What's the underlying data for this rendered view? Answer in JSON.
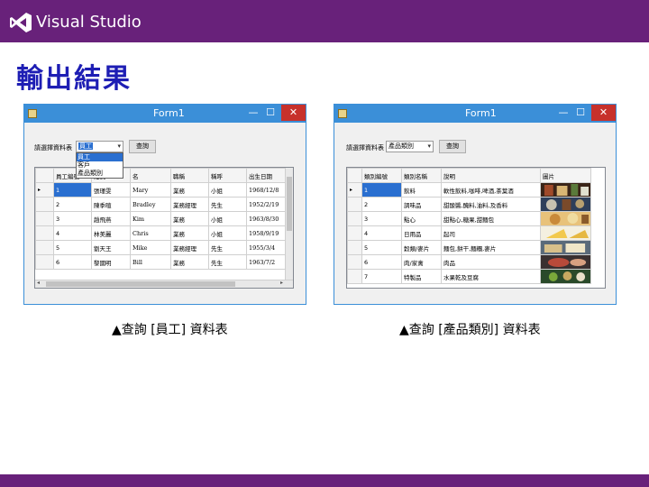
{
  "header": {
    "brand": "Visual Studio"
  },
  "slide_title": "輸出結果",
  "colors": {
    "brand_purple": "#68217a",
    "title_blue": "#1e1eb4",
    "window_blue": "#3b8fd8",
    "selection": "#2a6fd0"
  },
  "left_form": {
    "title": "Form1",
    "minimize": "—",
    "maximize": "☐",
    "close": "✕",
    "prompt": "請選擇資料表",
    "combo_value": "員工",
    "query_button": "查詢",
    "dropdown_options": [
      "員工",
      "客戶",
      "產品類別"
    ],
    "columns": [
      "員工編號",
      "姓氏",
      "名",
      "職稱",
      "稱呼",
      "出生日期"
    ],
    "rows": [
      [
        "1",
        "張瑾雯",
        "Mary",
        "業務",
        "小姐",
        "1968/12/8"
      ],
      [
        "2",
        "陳季暄",
        "Bradley",
        "業務經理",
        "先生",
        "1952/2/19"
      ],
      [
        "3",
        "趙飛燕",
        "Kim",
        "業務",
        "小姐",
        "1963/8/30"
      ],
      [
        "4",
        "林美麗",
        "Chris",
        "業務",
        "小姐",
        "1958/9/19"
      ],
      [
        "5",
        "劉天王",
        "Mike",
        "業務經理",
        "先生",
        "1955/3/4"
      ],
      [
        "6",
        "黎國明",
        "Bill",
        "業務",
        "先生",
        "1963/7/2"
      ]
    ],
    "caption": "▲查詢 [員工] 資料表"
  },
  "right_form": {
    "title": "Form1",
    "minimize": "—",
    "maximize": "☐",
    "close": "✕",
    "prompt": "請選擇資料表",
    "combo_value": "產品類別",
    "query_button": "查詢",
    "columns": [
      "類別編號",
      "類別名稱",
      "說明",
      "圖片"
    ],
    "rows": [
      [
        "1",
        "飲料",
        "軟性飲料,咖啡,啤酒,茶葉酒"
      ],
      [
        "2",
        "調味品",
        "甜酸醬,醃料,油料,及香料"
      ],
      [
        "3",
        "點心",
        "甜點心,糖果,甜麵包"
      ],
      [
        "4",
        "日用品",
        "起司"
      ],
      [
        "5",
        "穀類/麥片",
        "麵包,餅干,麵糰,麥片"
      ],
      [
        "6",
        "肉/家禽",
        "肉品"
      ],
      [
        "7",
        "特製品",
        "水果乾及豆腐"
      ]
    ],
    "pictures": [
      "beverage-photo",
      "condiment-photo",
      "dessert-photo",
      "cheese-photo",
      "grain-photo",
      "meat-photo",
      "produce-photo"
    ],
    "caption": "▲查詢 [產品類別] 資料表"
  }
}
